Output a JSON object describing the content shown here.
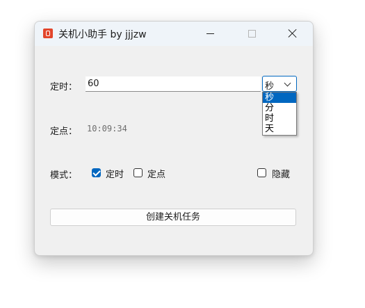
{
  "window": {
    "title": "关机小助手 by jjjzw",
    "app_icon": "power-icon"
  },
  "timer": {
    "label": "定时：",
    "value": "60",
    "unit_selected": "秒",
    "unit_options": [
      "秒",
      "分",
      "时",
      "天"
    ]
  },
  "fixed_time": {
    "label": "定点：",
    "value": "10:09:34"
  },
  "mode": {
    "label": "模式：",
    "timer_option": "定时",
    "timer_checked": true,
    "fixed_option": "定点",
    "fixed_checked": false,
    "hide_option": "隐藏",
    "hide_checked": false
  },
  "actions": {
    "create_label": "创建关机任务"
  },
  "colors": {
    "accent": "#0067c0",
    "icon": "#e2452b",
    "titlebar": "#eff4f9",
    "window_bg": "#f0f0f0"
  }
}
